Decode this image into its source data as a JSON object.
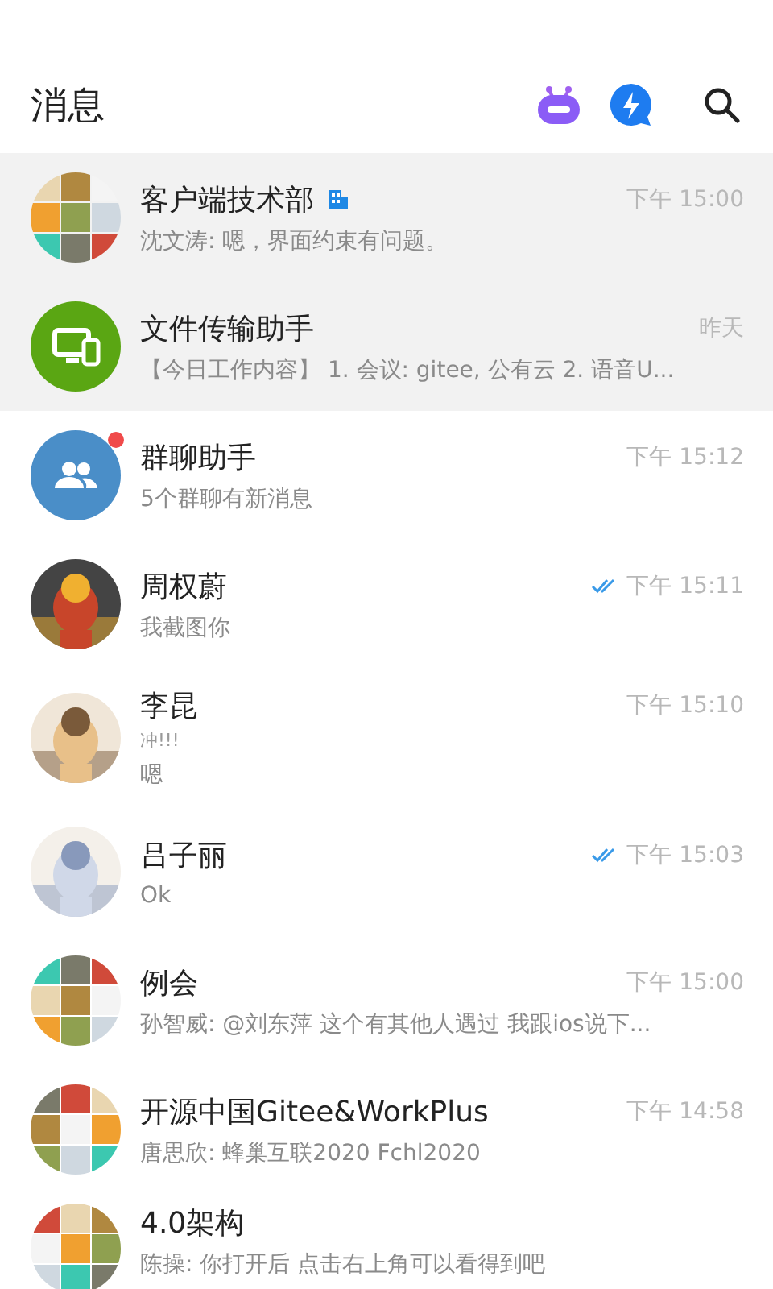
{
  "header": {
    "title": "消息"
  },
  "conversations": [
    {
      "name": "客户端技术部",
      "avatar": {
        "kind": "collage"
      },
      "pinned": true,
      "org_badge": true,
      "time": "下午 15:00",
      "preview": "沈文涛: 嗯，界面约束有问题。"
    },
    {
      "name": "文件传输助手",
      "avatar": {
        "kind": "monitor"
      },
      "pinned": true,
      "time": "昨天",
      "preview": "【今日工作内容】 1. 会议: gitee, 公有云 2. 语音U..."
    },
    {
      "name": "群聊助手",
      "avatar": {
        "kind": "group"
      },
      "pinned": false,
      "unread_dot": true,
      "time": "下午 15:12",
      "preview": "5个群聊有新消息"
    },
    {
      "name": "周权蔚",
      "pinned": false,
      "read": true,
      "time": "下午 15:11",
      "preview": "我截图你"
    },
    {
      "name": "李昆",
      "pinned": false,
      "time": "下午 15:10",
      "note": "冲!!!",
      "preview": "嗯"
    },
    {
      "name": "吕子丽",
      "pinned": false,
      "read": true,
      "time": "下午 15:03",
      "preview": "Ok"
    },
    {
      "name": "例会",
      "avatar": {
        "kind": "collage"
      },
      "pinned": false,
      "time": "下午 15:00",
      "preview": "孙智威: @刘东萍 这个有其他人遇过  我跟ios说下..."
    },
    {
      "name": "开源中国Gitee&WorkPlus",
      "avatar": {
        "kind": "collage"
      },
      "pinned": false,
      "time": "下午 14:58",
      "preview": "唐思欣: 蜂巢互联2020  Fchl2020"
    },
    {
      "name": "4.0架构",
      "avatar": {
        "kind": "collage"
      },
      "pinned": false,
      "preview": "陈操: 你打开后 点击右上角可以看得到吧"
    }
  ]
}
